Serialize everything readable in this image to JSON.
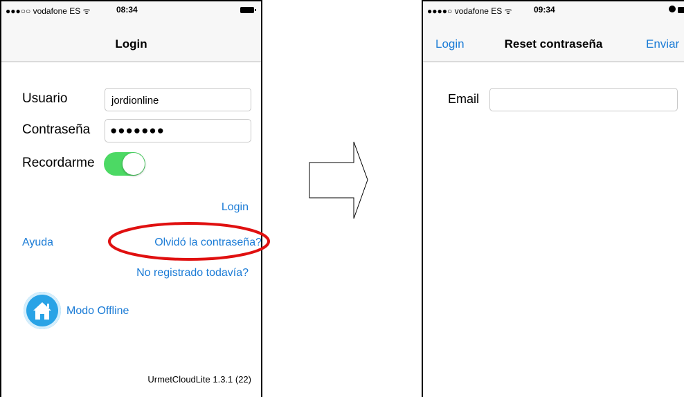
{
  "left": {
    "status": {
      "carrier": "●●●○○ vodafone ES ᯤ",
      "time": "08:34"
    },
    "nav_title": "Login",
    "user_label": "Usuario",
    "user_value": "jordionline",
    "password_label": "Contraseña",
    "password_value": "●●●●●●●",
    "remember_label": "Recordarme",
    "login_link": "Login",
    "help_link": "Ayuda",
    "forgot_link": "Olvidó la contraseña?",
    "register_link": "No registrado todavía?",
    "offline_label": "Modo Offline",
    "version": "UrmetCloudLite 1.3.1 (22)"
  },
  "right": {
    "status": {
      "carrier": "●●●●○ vodafone ES ᯤ",
      "time": "09:34"
    },
    "back_link": "Login",
    "nav_title": "Reset contraseña",
    "send_link": "Enviar",
    "email_label": "Email",
    "email_value": ""
  },
  "colors": {
    "link": "#1a7bd6",
    "toggle_on": "#4cd964",
    "highlight": "#e01010"
  }
}
